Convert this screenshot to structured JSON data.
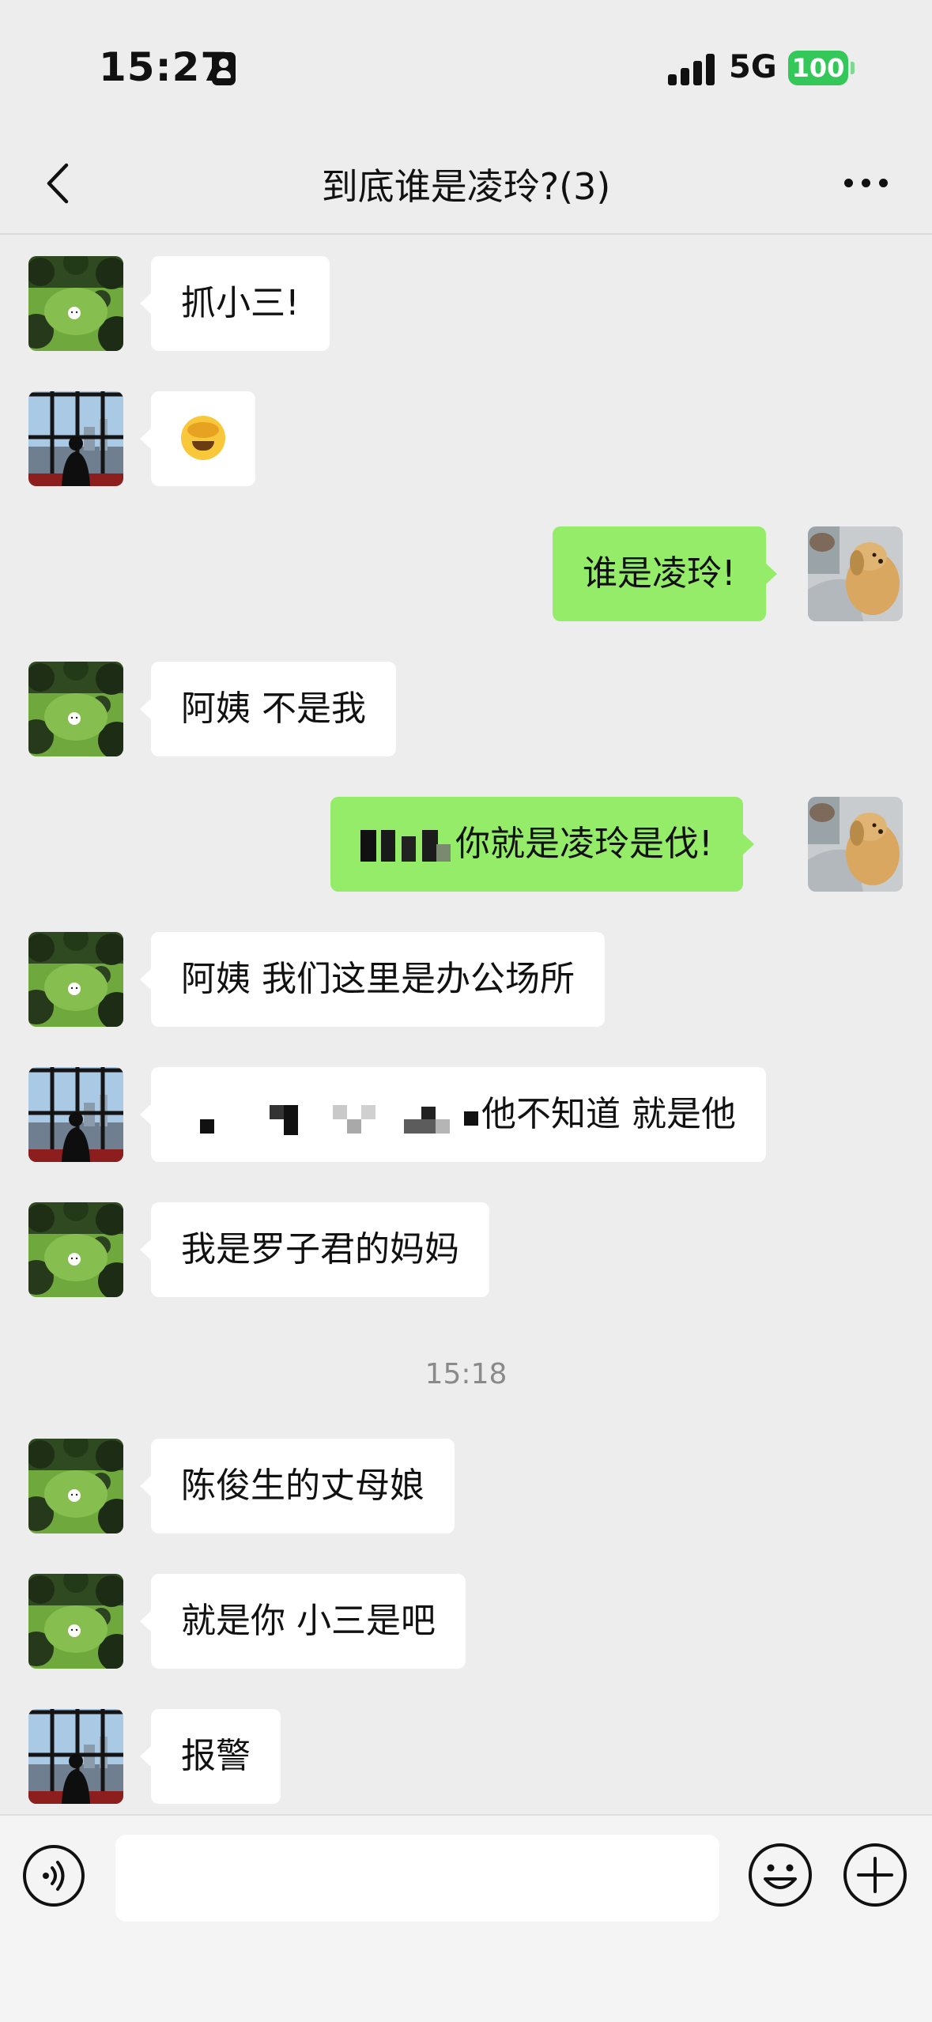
{
  "status_bar": {
    "time": "15:27",
    "network": "5G",
    "battery": "100"
  },
  "header": {
    "title": "到底谁是凌玲?(3)"
  },
  "messages": [
    {
      "side": "left",
      "avatar": "forest",
      "text": "抓小三!"
    },
    {
      "side": "left",
      "avatar": "window",
      "text": "",
      "emoji": "face-palm-emoji"
    },
    {
      "side": "right",
      "avatar": "dog",
      "text": "谁是凌玲!"
    },
    {
      "side": "left",
      "avatar": "forest",
      "text": "阿姨 不是我"
    },
    {
      "side": "right",
      "avatar": "dog",
      "text": "你就是凌玲是伐!"
    },
    {
      "side": "left",
      "avatar": "forest",
      "text": "阿姨 我们这里是办公场所"
    },
    {
      "side": "left",
      "avatar": "window",
      "text": "他不知道 就是他"
    },
    {
      "side": "left",
      "avatar": "forest",
      "text": "我是罗子君的妈妈"
    },
    {
      "side": "left",
      "avatar": "forest",
      "text": "陈俊生的丈母娘"
    },
    {
      "side": "left",
      "avatar": "forest",
      "text": "就是你 小三是吧"
    },
    {
      "side": "left",
      "avatar": "window",
      "text": "报警"
    }
  ],
  "timestamp": "15:18",
  "input": {
    "value": ""
  },
  "colors": {
    "sent_bubble": "#95ec69",
    "received_bubble": "#ffffff",
    "background": "#ededed",
    "battery": "#34c759"
  },
  "icons": [
    "id-card-icon",
    "signal-icon",
    "back-icon",
    "more-icon",
    "voice-icon",
    "emoji-icon",
    "plus-icon"
  ]
}
